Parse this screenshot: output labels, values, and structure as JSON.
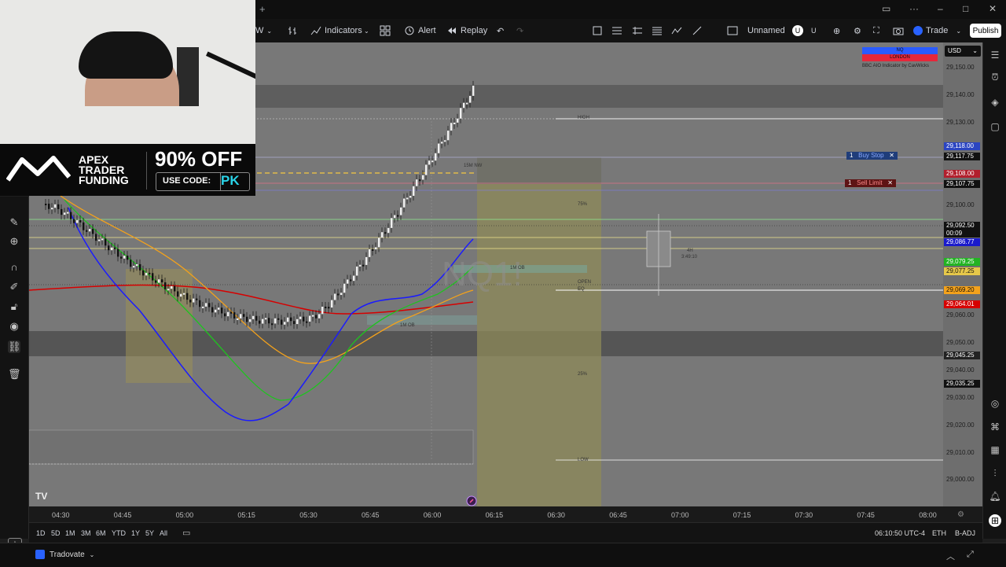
{
  "toolbar": {
    "interval": "W",
    "indicators": "Indicators",
    "alert": "Alert",
    "replay": "Replay",
    "layout_name": "Unnamed",
    "trade": "Trade",
    "publish": "Publish"
  },
  "promo": {
    "brand_line1": "APEX",
    "brand_line2": "TRADER",
    "brand_line3": "FUNDING",
    "discount": "90% OFF",
    "use_code": "USE CODE:",
    "code": "PK"
  },
  "chart": {
    "watermark": "NQ1!",
    "labels": {
      "high": "HIGH",
      "low": "LOW",
      "ob_15m": "15M NW",
      "ob_1m": "1M OB",
      "ob_1m_b": "1M OB",
      "pct75": "75%",
      "pct25": "25%",
      "open": "OPEN",
      "eq": "EQ",
      "box4h": "4H",
      "box4h_count": "3:49:10"
    },
    "indicator_legend": {
      "nq": "NQ",
      "london": "LONDON",
      "credit": "BBC AIO Indicator by CavWicks"
    },
    "orders": {
      "buy_qty": "1",
      "buy_label": "Buy Stop",
      "sell_qty": "1",
      "sell_label": "Sell Limit"
    },
    "colors": {
      "red_ma": "#d60000",
      "blue_ma": "#1a1aff",
      "green_ma": "#1fc31f",
      "orange_ma": "#f4a21b",
      "background": "#787878"
    }
  },
  "price_axis": {
    "currency": "USD",
    "labels": [
      "29,150.00",
      "29,140.00",
      "29,130.00",
      "29,100.00",
      "29,060.00",
      "29,050.00",
      "29,040.00",
      "29,030.00",
      "29,020.00",
      "29,010.00",
      "29,000.00"
    ],
    "tags": {
      "t29118": "29,118.00",
      "t29117": "29,117.75",
      "t29108": "29,108.00",
      "t29107": "29,107.75",
      "last": "29,092.50",
      "countdown": "00:09",
      "t29086": "29,086.77",
      "t29079": "29,079.25",
      "t29077": "29,077.25",
      "t29069": "29,069.20",
      "t29064": "29,064.01",
      "t29045": "29,045.25",
      "t29035": "29,035.25"
    }
  },
  "time_axis": [
    "04:30",
    "04:45",
    "05:00",
    "05:15",
    "05:30",
    "05:45",
    "06:00",
    "06:15",
    "06:30",
    "06:45",
    "07:00",
    "07:15",
    "07:30",
    "07:45",
    "08:00"
  ],
  "ranges": [
    "1D",
    "5D",
    "1M",
    "3M",
    "6M",
    "YTD",
    "1Y",
    "5Y",
    "All"
  ],
  "status": {
    "clock": "06:10:50 UTC-4",
    "session": "ETH",
    "adj": "B-ADJ"
  },
  "broker": {
    "name": "Tradovate"
  }
}
